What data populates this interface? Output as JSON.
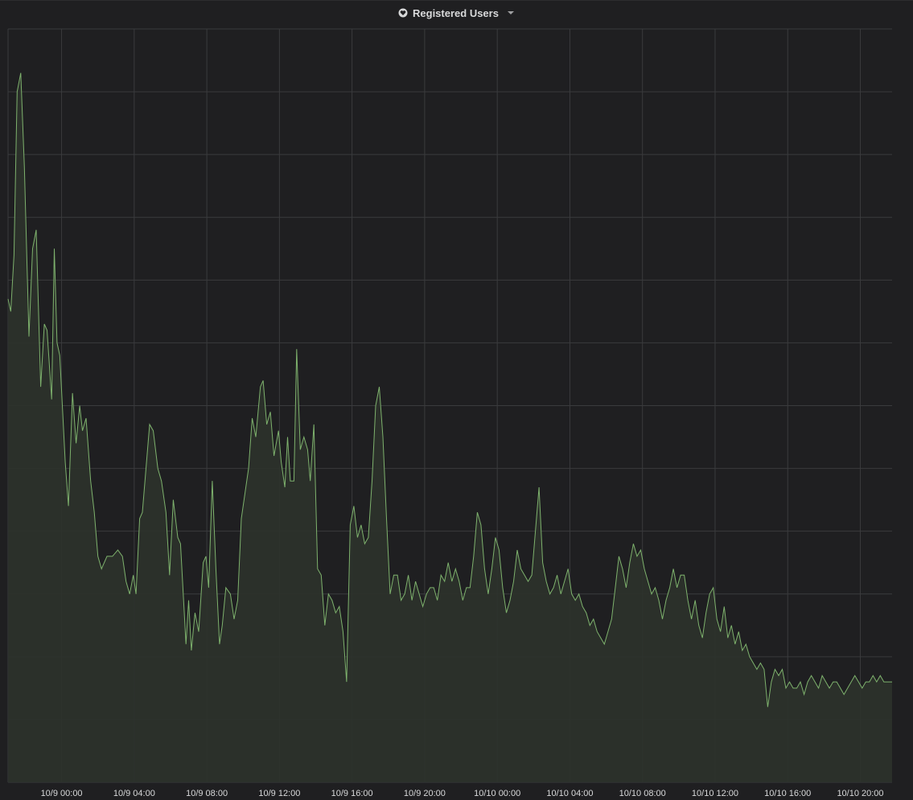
{
  "panel": {
    "title": "Registered Users",
    "title_icon": "heart-icon",
    "menu_icon": "caret-down-icon"
  },
  "colors": {
    "background": "#1f1f21",
    "grid": "#3a3b3d",
    "line": "#7eb26d",
    "fill": "#2c322b",
    "text": "#d8d9da"
  },
  "chart_data": {
    "type": "area",
    "title": "Registered Users",
    "xlabel": "",
    "ylabel": "",
    "grid": true,
    "legend": "none",
    "x_ticks": [
      "10/9 00:00",
      "10/9 04:00",
      "10/9 08:00",
      "10/9 12:00",
      "10/9 16:00",
      "10/9 20:00",
      "10/10 00:00",
      "10/10 04:00",
      "10/10 08:00",
      "10/10 12:00",
      "10/10 16:00",
      "10/10 20:00"
    ],
    "x_range_hours": [
      -2.95,
      45.75
    ],
    "y_range": [
      0,
      12
    ],
    "y_gridlines": 12,
    "series": [
      {
        "points": [
          [
            -2.95,
            7.7
          ],
          [
            -2.8,
            7.5
          ],
          [
            -2.62,
            8.4
          ],
          [
            -2.45,
            11.0
          ],
          [
            -2.25,
            11.3
          ],
          [
            -2.05,
            9.8
          ],
          [
            -1.8,
            7.1
          ],
          [
            -1.6,
            8.5
          ],
          [
            -1.4,
            8.8
          ],
          [
            -1.15,
            6.3
          ],
          [
            -0.95,
            7.3
          ],
          [
            -0.8,
            7.2
          ],
          [
            -0.55,
            6.1
          ],
          [
            -0.4,
            8.5
          ],
          [
            -0.25,
            7.0
          ],
          [
            -0.1,
            6.8
          ],
          [
            0.2,
            5.1
          ],
          [
            0.38,
            4.4
          ],
          [
            0.6,
            6.2
          ],
          [
            0.8,
            5.4
          ],
          [
            1.0,
            6.0
          ],
          [
            1.15,
            5.6
          ],
          [
            1.35,
            5.8
          ],
          [
            1.6,
            4.8
          ],
          [
            1.8,
            4.3
          ],
          [
            2.0,
            3.6
          ],
          [
            2.2,
            3.4
          ],
          [
            2.5,
            3.6
          ],
          [
            2.8,
            3.6
          ],
          [
            3.1,
            3.7
          ],
          [
            3.35,
            3.6
          ],
          [
            3.55,
            3.2
          ],
          [
            3.75,
            3.0
          ],
          [
            3.95,
            3.3
          ],
          [
            4.1,
            3.0
          ],
          [
            4.3,
            4.2
          ],
          [
            4.45,
            4.3
          ],
          [
            4.65,
            5.0
          ],
          [
            4.85,
            5.7
          ],
          [
            5.05,
            5.6
          ],
          [
            5.3,
            5.0
          ],
          [
            5.5,
            4.8
          ],
          [
            5.75,
            4.3
          ],
          [
            5.95,
            3.3
          ],
          [
            6.15,
            4.5
          ],
          [
            6.4,
            3.9
          ],
          [
            6.55,
            3.8
          ],
          [
            6.85,
            2.2
          ],
          [
            7.0,
            2.9
          ],
          [
            7.15,
            2.1
          ],
          [
            7.35,
            2.7
          ],
          [
            7.55,
            2.4
          ],
          [
            7.8,
            3.5
          ],
          [
            7.95,
            3.6
          ],
          [
            8.1,
            3.1
          ],
          [
            8.3,
            4.8
          ],
          [
            8.5,
            3.4
          ],
          [
            8.7,
            2.2
          ],
          [
            8.85,
            2.5
          ],
          [
            9.05,
            3.1
          ],
          [
            9.3,
            3.0
          ],
          [
            9.5,
            2.6
          ],
          [
            9.7,
            2.9
          ],
          [
            9.9,
            4.2
          ],
          [
            10.1,
            4.6
          ],
          [
            10.3,
            5.0
          ],
          [
            10.5,
            5.8
          ],
          [
            10.7,
            5.5
          ],
          [
            10.95,
            6.3
          ],
          [
            11.1,
            6.4
          ],
          [
            11.3,
            5.7
          ],
          [
            11.5,
            5.9
          ],
          [
            11.7,
            5.2
          ],
          [
            11.95,
            5.6
          ],
          [
            12.1,
            5.1
          ],
          [
            12.3,
            4.7
          ],
          [
            12.45,
            5.5
          ],
          [
            12.6,
            4.8
          ],
          [
            12.8,
            4.8
          ],
          [
            12.95,
            6.9
          ],
          [
            13.15,
            5.3
          ],
          [
            13.35,
            5.5
          ],
          [
            13.55,
            5.3
          ],
          [
            13.7,
            4.8
          ],
          [
            13.9,
            5.7
          ],
          [
            14.1,
            3.4
          ],
          [
            14.3,
            3.3
          ],
          [
            14.5,
            2.5
          ],
          [
            14.7,
            3.0
          ],
          [
            14.9,
            2.9
          ],
          [
            15.1,
            2.7
          ],
          [
            15.3,
            2.8
          ],
          [
            15.5,
            2.4
          ],
          [
            15.7,
            1.6
          ],
          [
            15.9,
            4.1
          ],
          [
            16.1,
            4.4
          ],
          [
            16.3,
            3.9
          ],
          [
            16.5,
            4.1
          ],
          [
            16.7,
            3.8
          ],
          [
            16.9,
            3.9
          ],
          [
            17.1,
            4.8
          ],
          [
            17.3,
            6.0
          ],
          [
            17.5,
            6.3
          ],
          [
            17.7,
            5.5
          ],
          [
            17.9,
            4.2
          ],
          [
            18.1,
            3.0
          ],
          [
            18.3,
            3.3
          ],
          [
            18.5,
            3.3
          ],
          [
            18.7,
            2.9
          ],
          [
            18.9,
            3.0
          ],
          [
            19.1,
            3.3
          ],
          [
            19.3,
            2.9
          ],
          [
            19.5,
            3.2
          ],
          [
            19.7,
            3.0
          ],
          [
            19.9,
            2.8
          ],
          [
            20.1,
            3.0
          ],
          [
            20.3,
            3.1
          ],
          [
            20.5,
            3.1
          ],
          [
            20.7,
            2.9
          ],
          [
            20.9,
            3.3
          ],
          [
            21.1,
            3.2
          ],
          [
            21.3,
            3.5
          ],
          [
            21.5,
            3.2
          ],
          [
            21.7,
            3.4
          ],
          [
            21.9,
            3.2
          ],
          [
            22.1,
            2.9
          ],
          [
            22.3,
            3.1
          ],
          [
            22.5,
            3.1
          ],
          [
            22.7,
            3.6
          ],
          [
            22.9,
            4.3
          ],
          [
            23.1,
            4.1
          ],
          [
            23.3,
            3.4
          ],
          [
            23.5,
            3.0
          ],
          [
            23.7,
            3.4
          ],
          [
            23.9,
            3.9
          ],
          [
            24.1,
            3.7
          ],
          [
            24.3,
            3.1
          ],
          [
            24.5,
            2.7
          ],
          [
            24.7,
            2.9
          ],
          [
            24.9,
            3.2
          ],
          [
            25.1,
            3.7
          ],
          [
            25.3,
            3.4
          ],
          [
            25.5,
            3.3
          ],
          [
            25.7,
            3.2
          ],
          [
            25.9,
            3.3
          ],
          [
            26.1,
            4.0
          ],
          [
            26.3,
            4.7
          ],
          [
            26.5,
            3.5
          ],
          [
            26.7,
            3.2
          ],
          [
            26.9,
            3.0
          ],
          [
            27.1,
            3.1
          ],
          [
            27.3,
            3.3
          ],
          [
            27.5,
            3.0
          ],
          [
            27.7,
            3.2
          ],
          [
            27.9,
            3.4
          ],
          [
            28.1,
            3.0
          ],
          [
            28.3,
            2.9
          ],
          [
            28.5,
            3.0
          ],
          [
            28.7,
            2.8
          ],
          [
            28.9,
            2.7
          ],
          [
            29.1,
            2.5
          ],
          [
            29.3,
            2.6
          ],
          [
            29.5,
            2.4
          ],
          [
            29.7,
            2.3
          ],
          [
            29.9,
            2.2
          ],
          [
            30.1,
            2.4
          ],
          [
            30.3,
            2.6
          ],
          [
            30.5,
            3.1
          ],
          [
            30.7,
            3.6
          ],
          [
            30.9,
            3.4
          ],
          [
            31.1,
            3.1
          ],
          [
            31.3,
            3.5
          ],
          [
            31.5,
            3.8
          ],
          [
            31.7,
            3.6
          ],
          [
            31.9,
            3.7
          ],
          [
            32.1,
            3.4
          ],
          [
            32.3,
            3.2
          ],
          [
            32.5,
            3.0
          ],
          [
            32.7,
            3.1
          ],
          [
            32.9,
            2.9
          ],
          [
            33.1,
            2.6
          ],
          [
            33.3,
            2.9
          ],
          [
            33.5,
            3.1
          ],
          [
            33.7,
            3.4
          ],
          [
            33.9,
            3.1
          ],
          [
            34.1,
            3.3
          ],
          [
            34.3,
            3.3
          ],
          [
            34.5,
            2.9
          ],
          [
            34.7,
            2.6
          ],
          [
            34.9,
            2.9
          ],
          [
            35.1,
            2.5
          ],
          [
            35.3,
            2.3
          ],
          [
            35.5,
            2.7
          ],
          [
            35.7,
            3.0
          ],
          [
            35.9,
            3.1
          ],
          [
            36.1,
            2.6
          ],
          [
            36.3,
            2.4
          ],
          [
            36.5,
            2.8
          ],
          [
            36.7,
            2.3
          ],
          [
            36.9,
            2.5
          ],
          [
            37.1,
            2.2
          ],
          [
            37.3,
            2.4
          ],
          [
            37.5,
            2.1
          ],
          [
            37.7,
            2.2
          ],
          [
            37.9,
            2.0
          ],
          [
            38.1,
            1.9
          ],
          [
            38.3,
            1.8
          ],
          [
            38.5,
            1.9
          ],
          [
            38.7,
            1.8
          ],
          [
            38.9,
            1.2
          ],
          [
            39.1,
            1.6
          ],
          [
            39.3,
            1.8
          ],
          [
            39.5,
            1.7
          ],
          [
            39.7,
            1.8
          ],
          [
            39.9,
            1.5
          ],
          [
            40.1,
            1.6
          ],
          [
            40.3,
            1.5
          ],
          [
            40.5,
            1.5
          ],
          [
            40.7,
            1.6
          ],
          [
            40.9,
            1.4
          ],
          [
            41.1,
            1.6
          ],
          [
            41.3,
            1.7
          ],
          [
            41.5,
            1.6
          ],
          [
            41.7,
            1.5
          ],
          [
            41.9,
            1.7
          ],
          [
            42.1,
            1.6
          ],
          [
            42.3,
            1.5
          ],
          [
            42.5,
            1.6
          ],
          [
            42.7,
            1.6
          ],
          [
            42.9,
            1.5
          ],
          [
            43.1,
            1.4
          ],
          [
            43.3,
            1.5
          ],
          [
            43.5,
            1.6
          ],
          [
            43.7,
            1.7
          ],
          [
            43.9,
            1.6
          ],
          [
            44.1,
            1.5
          ],
          [
            44.3,
            1.6
          ],
          [
            44.5,
            1.6
          ],
          [
            44.7,
            1.7
          ],
          [
            44.9,
            1.6
          ],
          [
            45.1,
            1.7
          ],
          [
            45.3,
            1.6
          ],
          [
            45.5,
            1.6
          ],
          [
            45.75,
            1.6
          ]
        ]
      }
    ]
  }
}
